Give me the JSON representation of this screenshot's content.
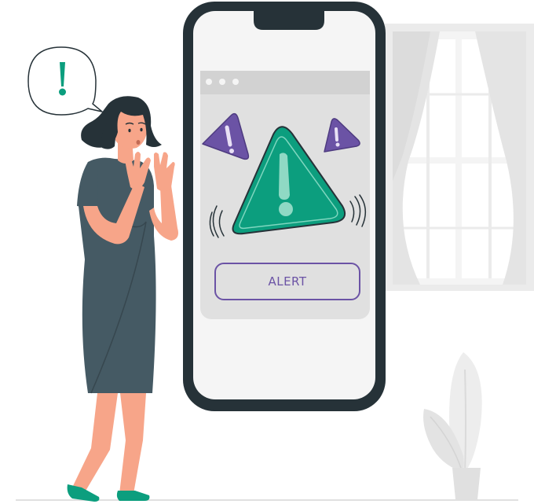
{
  "speech_bubble": {
    "symbol": "!"
  },
  "browser_bar": {
    "dots": 3
  },
  "alert_button": {
    "label": "ALERT"
  },
  "colors": {
    "accent_green": "#0c9e7e",
    "accent_purple": "#6b53a5",
    "phone_frame": "#263238",
    "screen_bg": "#f5f5f5",
    "dress": "#455a64",
    "skin": "#f7a589"
  }
}
